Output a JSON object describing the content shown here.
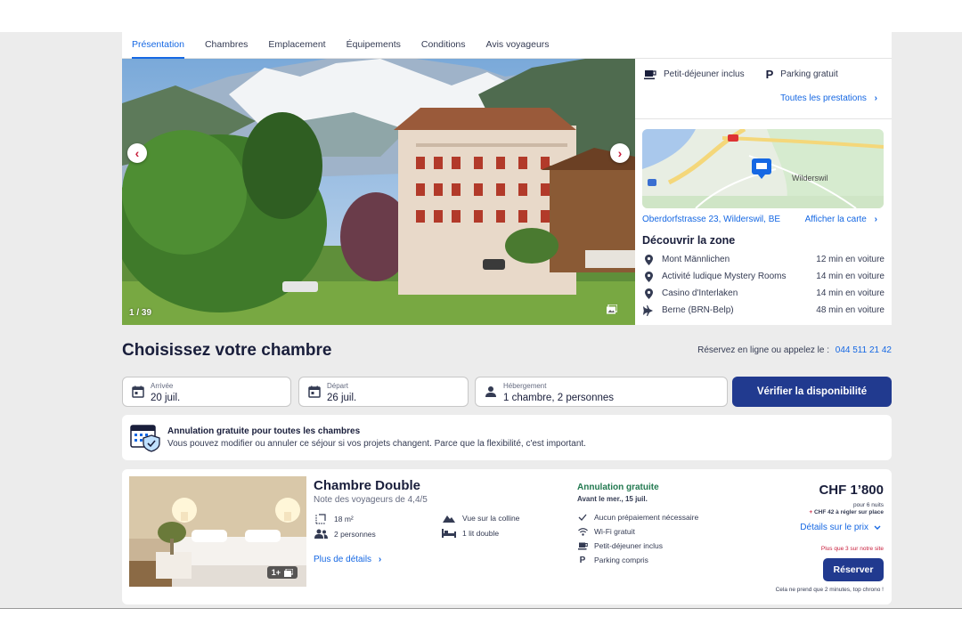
{
  "tabs": [
    {
      "label": "Présentation",
      "active": true
    },
    {
      "label": "Chambres"
    },
    {
      "label": "Emplacement"
    },
    {
      "label": "Équipements"
    },
    {
      "label": "Conditions"
    },
    {
      "label": "Avis voyageurs"
    }
  ],
  "gallery": {
    "counter": "1 / 39",
    "prev_icon": "chevron-left-icon",
    "next_icon": "chevron-right-icon"
  },
  "amenities": {
    "breakfast": "Petit-déjeuner inclus",
    "parking": "Parking gratuit",
    "all_link": "Toutes les prestations"
  },
  "map": {
    "town_label": "Wilderswil",
    "address": "Oberdorfstrasse 23, Wilderswil, BE",
    "show_map": "Afficher la carte"
  },
  "zone": {
    "title": "Découvrir la zone",
    "items": [
      {
        "name": "Mont Männlichen",
        "distance": "12 min en voiture",
        "icon": "pin-icon"
      },
      {
        "name": "Activité ludique Mystery Rooms",
        "distance": "14 min en voiture",
        "icon": "pin-icon"
      },
      {
        "name": "Casino d'Interlaken",
        "distance": "14 min en voiture",
        "icon": "pin-icon"
      },
      {
        "name": "Berne (BRN-Belp)",
        "distance": "48 min en voiture",
        "icon": "plane-icon"
      }
    ]
  },
  "rooms_section": {
    "title": "Choisissez votre chambre",
    "phone_label": "Réservez en ligne ou appelez le :",
    "phone": "044 511 21 42"
  },
  "search": {
    "arrival_label": "Arrivée",
    "arrival_value": "20 juil.",
    "departure_label": "Départ",
    "departure_value": "26 juil.",
    "guests_label": "Hébergement",
    "guests_value": "1 chambre, 2 personnes",
    "check_button": "Vérifier la disponibilité"
  },
  "cancellation": {
    "title": "Annulation gratuite pour toutes les chambres",
    "description": "Vous pouvez modifier ou annuler ce séjour si vos projets changent. Parce que la flexibilité, c'est important."
  },
  "room": {
    "name": "Chambre Double",
    "score": "Note des voyageurs de 4,4/5",
    "image_count": "1+",
    "features": {
      "area": "18 m²",
      "view": "Vue sur la colline",
      "people": "2 personnes",
      "bed": "1 lit double"
    },
    "details_link": "Plus de détails",
    "free_cancel": "Annulation gratuite",
    "free_cancel_date": "Avant le mer., 15 juil.",
    "inclusions": [
      {
        "label": "Aucun prépaiement nécessaire",
        "icon": "check-icon"
      },
      {
        "label": "Wi-Fi gratuit",
        "icon": "wifi-icon"
      },
      {
        "label": "Petit-déjeuner inclus",
        "icon": "coffee-icon"
      },
      {
        "label": "Parking compris",
        "icon": "parking-icon"
      }
    ],
    "price": "CHF 1’800",
    "nights": "pour 6 nuits",
    "tax_plus": "+",
    "tax": "CHF 42 à régler sur place",
    "price_details": "Détails sur le prix",
    "scarcity": "Plus que 3 sur notre site",
    "reserve_button": "Réserver",
    "quick_note": "Cela ne prend que 2 minutes, top chrono !"
  },
  "colors": {
    "accent_blue": "#1668e3",
    "button_navy": "#213a8f",
    "green": "#227950",
    "red": "#c81e3c"
  }
}
